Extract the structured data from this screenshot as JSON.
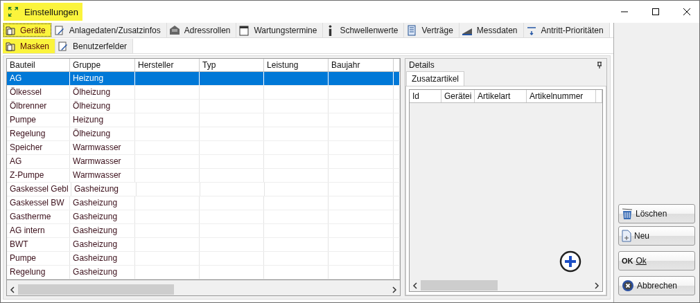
{
  "window": {
    "title": "Einstellungen"
  },
  "tabs": [
    {
      "label": "Geräte",
      "selected": true
    },
    {
      "label": "Anlagedaten/Zusatzinfos",
      "selected": false
    },
    {
      "label": "Adressrollen",
      "selected": false
    },
    {
      "label": "Wartungstermine",
      "selected": false
    },
    {
      "label": "Schwellenwerte",
      "selected": false
    },
    {
      "label": "Verträge",
      "selected": false
    },
    {
      "label": "Messdaten",
      "selected": false
    },
    {
      "label": "Antritt-Prioritäten",
      "selected": false
    }
  ],
  "subtabs": [
    {
      "label": "Masken",
      "selected": true
    },
    {
      "label": "Benutzerfelder",
      "selected": false
    }
  ],
  "table": {
    "columns": [
      "Bauteil",
      "Gruppe",
      "Hersteller",
      "Typ",
      "Leistung",
      "Baujahr"
    ],
    "rows": [
      {
        "bauteil": "AG",
        "gruppe": "Heizung",
        "selected": true
      },
      {
        "bauteil": "Ölkessel",
        "gruppe": "Ölheizung",
        "selected": false
      },
      {
        "bauteil": "Ölbrenner",
        "gruppe": "Ölheizung",
        "selected": false
      },
      {
        "bauteil": "Pumpe",
        "gruppe": "Heizung",
        "selected": false
      },
      {
        "bauteil": "Regelung",
        "gruppe": "Ölheizung",
        "selected": false
      },
      {
        "bauteil": "Speicher",
        "gruppe": "Warmwasser",
        "selected": false
      },
      {
        "bauteil": "AG",
        "gruppe": "Warmwasser",
        "selected": false
      },
      {
        "bauteil": "Z-Pumpe",
        "gruppe": "Warmwasser",
        "selected": false
      },
      {
        "bauteil": "Gaskessel Gebl",
        "gruppe": "Gasheizung",
        "selected": false
      },
      {
        "bauteil": "Gaskessel BW",
        "gruppe": "Gasheizung",
        "selected": false
      },
      {
        "bauteil": "Gastherme",
        "gruppe": "Gasheizung",
        "selected": false
      },
      {
        "bauteil": "AG intern",
        "gruppe": "Gasheizung",
        "selected": false
      },
      {
        "bauteil": "BWT",
        "gruppe": "Gasheizung",
        "selected": false
      },
      {
        "bauteil": "Pumpe",
        "gruppe": "Gasheizung",
        "selected": false
      },
      {
        "bauteil": "Regelung",
        "gruppe": "Gasheizung",
        "selected": false
      }
    ]
  },
  "details": {
    "title": "Details",
    "tab": "Zusatzartikel",
    "columns": [
      "Id",
      "Gerätei",
      "Artikelart",
      "Artikelnummer"
    ]
  },
  "buttons": [
    {
      "label": "Löschen",
      "kind": "delete"
    },
    {
      "label": "Neu",
      "kind": "new"
    },
    {
      "label": "Ok",
      "kind": "ok"
    },
    {
      "label": "Abbrechen",
      "kind": "cancel"
    }
  ],
  "ok_icon_text": "OK"
}
